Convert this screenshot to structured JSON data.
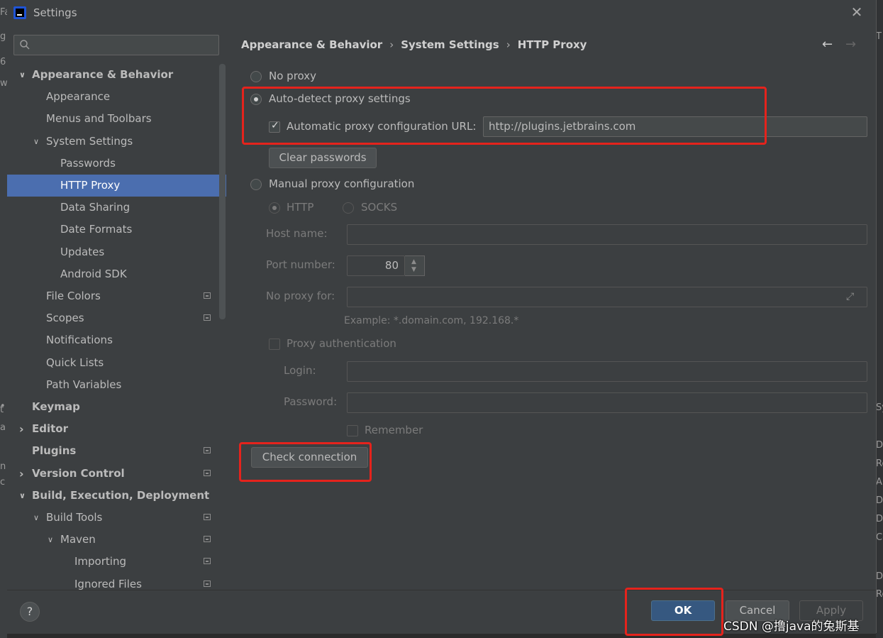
{
  "window": {
    "title": "Settings"
  },
  "search": {
    "placeholder": ""
  },
  "tree": [
    {
      "label": "Appearance & Behavior",
      "level": 0,
      "bold": true,
      "arrow": "expanded"
    },
    {
      "label": "Appearance",
      "level": 1
    },
    {
      "label": "Menus and Toolbars",
      "level": 1
    },
    {
      "label": "System Settings",
      "level": 1,
      "arrow": "expanded"
    },
    {
      "label": "Passwords",
      "level": 2
    },
    {
      "label": "HTTP Proxy",
      "level": 2,
      "selected": true
    },
    {
      "label": "Data Sharing",
      "level": 2
    },
    {
      "label": "Date Formats",
      "level": 2
    },
    {
      "label": "Updates",
      "level": 2
    },
    {
      "label": "Android SDK",
      "level": 2
    },
    {
      "label": "File Colors",
      "level": 1,
      "tag": true
    },
    {
      "label": "Scopes",
      "level": 1,
      "tag": true
    },
    {
      "label": "Notifications",
      "level": 1
    },
    {
      "label": "Quick Lists",
      "level": 1
    },
    {
      "label": "Path Variables",
      "level": 1
    },
    {
      "label": "Keymap",
      "level": 0,
      "bold": true
    },
    {
      "label": "Editor",
      "level": 0,
      "bold": true,
      "arrow": "collapsed"
    },
    {
      "label": "Plugins",
      "level": 0,
      "bold": true,
      "tag": true
    },
    {
      "label": "Version Control",
      "level": 0,
      "bold": true,
      "arrow": "collapsed",
      "tag": true
    },
    {
      "label": "Build, Execution, Deployment",
      "level": 0,
      "bold": true,
      "arrow": "expanded"
    },
    {
      "label": "Build Tools",
      "level": 1,
      "arrow": "expanded",
      "tag": true
    },
    {
      "label": "Maven",
      "level": 2,
      "arrow": "expanded",
      "tag": true
    },
    {
      "label": "Importing",
      "level": 3,
      "tag": true
    },
    {
      "label": "Ignored Files",
      "level": 3,
      "tag": true
    }
  ],
  "breadcrumb": {
    "root": "Appearance & Behavior",
    "middle": "System Settings",
    "current": "HTTP Proxy"
  },
  "proxy": {
    "no_proxy": "No proxy",
    "auto_detect": "Auto-detect proxy settings",
    "auto_config_url_label": "Automatic proxy configuration URL:",
    "auto_config_url_value": "http://plugins.jetbrains.com",
    "clear_passwords": "Clear passwords",
    "manual": "Manual proxy configuration",
    "http": "HTTP",
    "socks": "SOCKS",
    "host_label": "Host name:",
    "host_value": "",
    "port_label": "Port number:",
    "port_value": "80",
    "no_proxy_for_label": "No proxy for:",
    "no_proxy_for_value": "",
    "example": "Example: *.domain.com, 192.168.*",
    "auth": "Proxy authentication",
    "login_label": "Login:",
    "password_label": "Password:",
    "remember": "Remember",
    "check_connection": "Check connection"
  },
  "footer": {
    "help": "?",
    "ok": "OK",
    "cancel": "Cancel",
    "apply": "Apply"
  },
  "watermark": "CSDN @撸java的兔斯基",
  "colors": {
    "highlight": "#e5231c",
    "selection": "#4b6eaf",
    "primary_button": "#365880"
  }
}
